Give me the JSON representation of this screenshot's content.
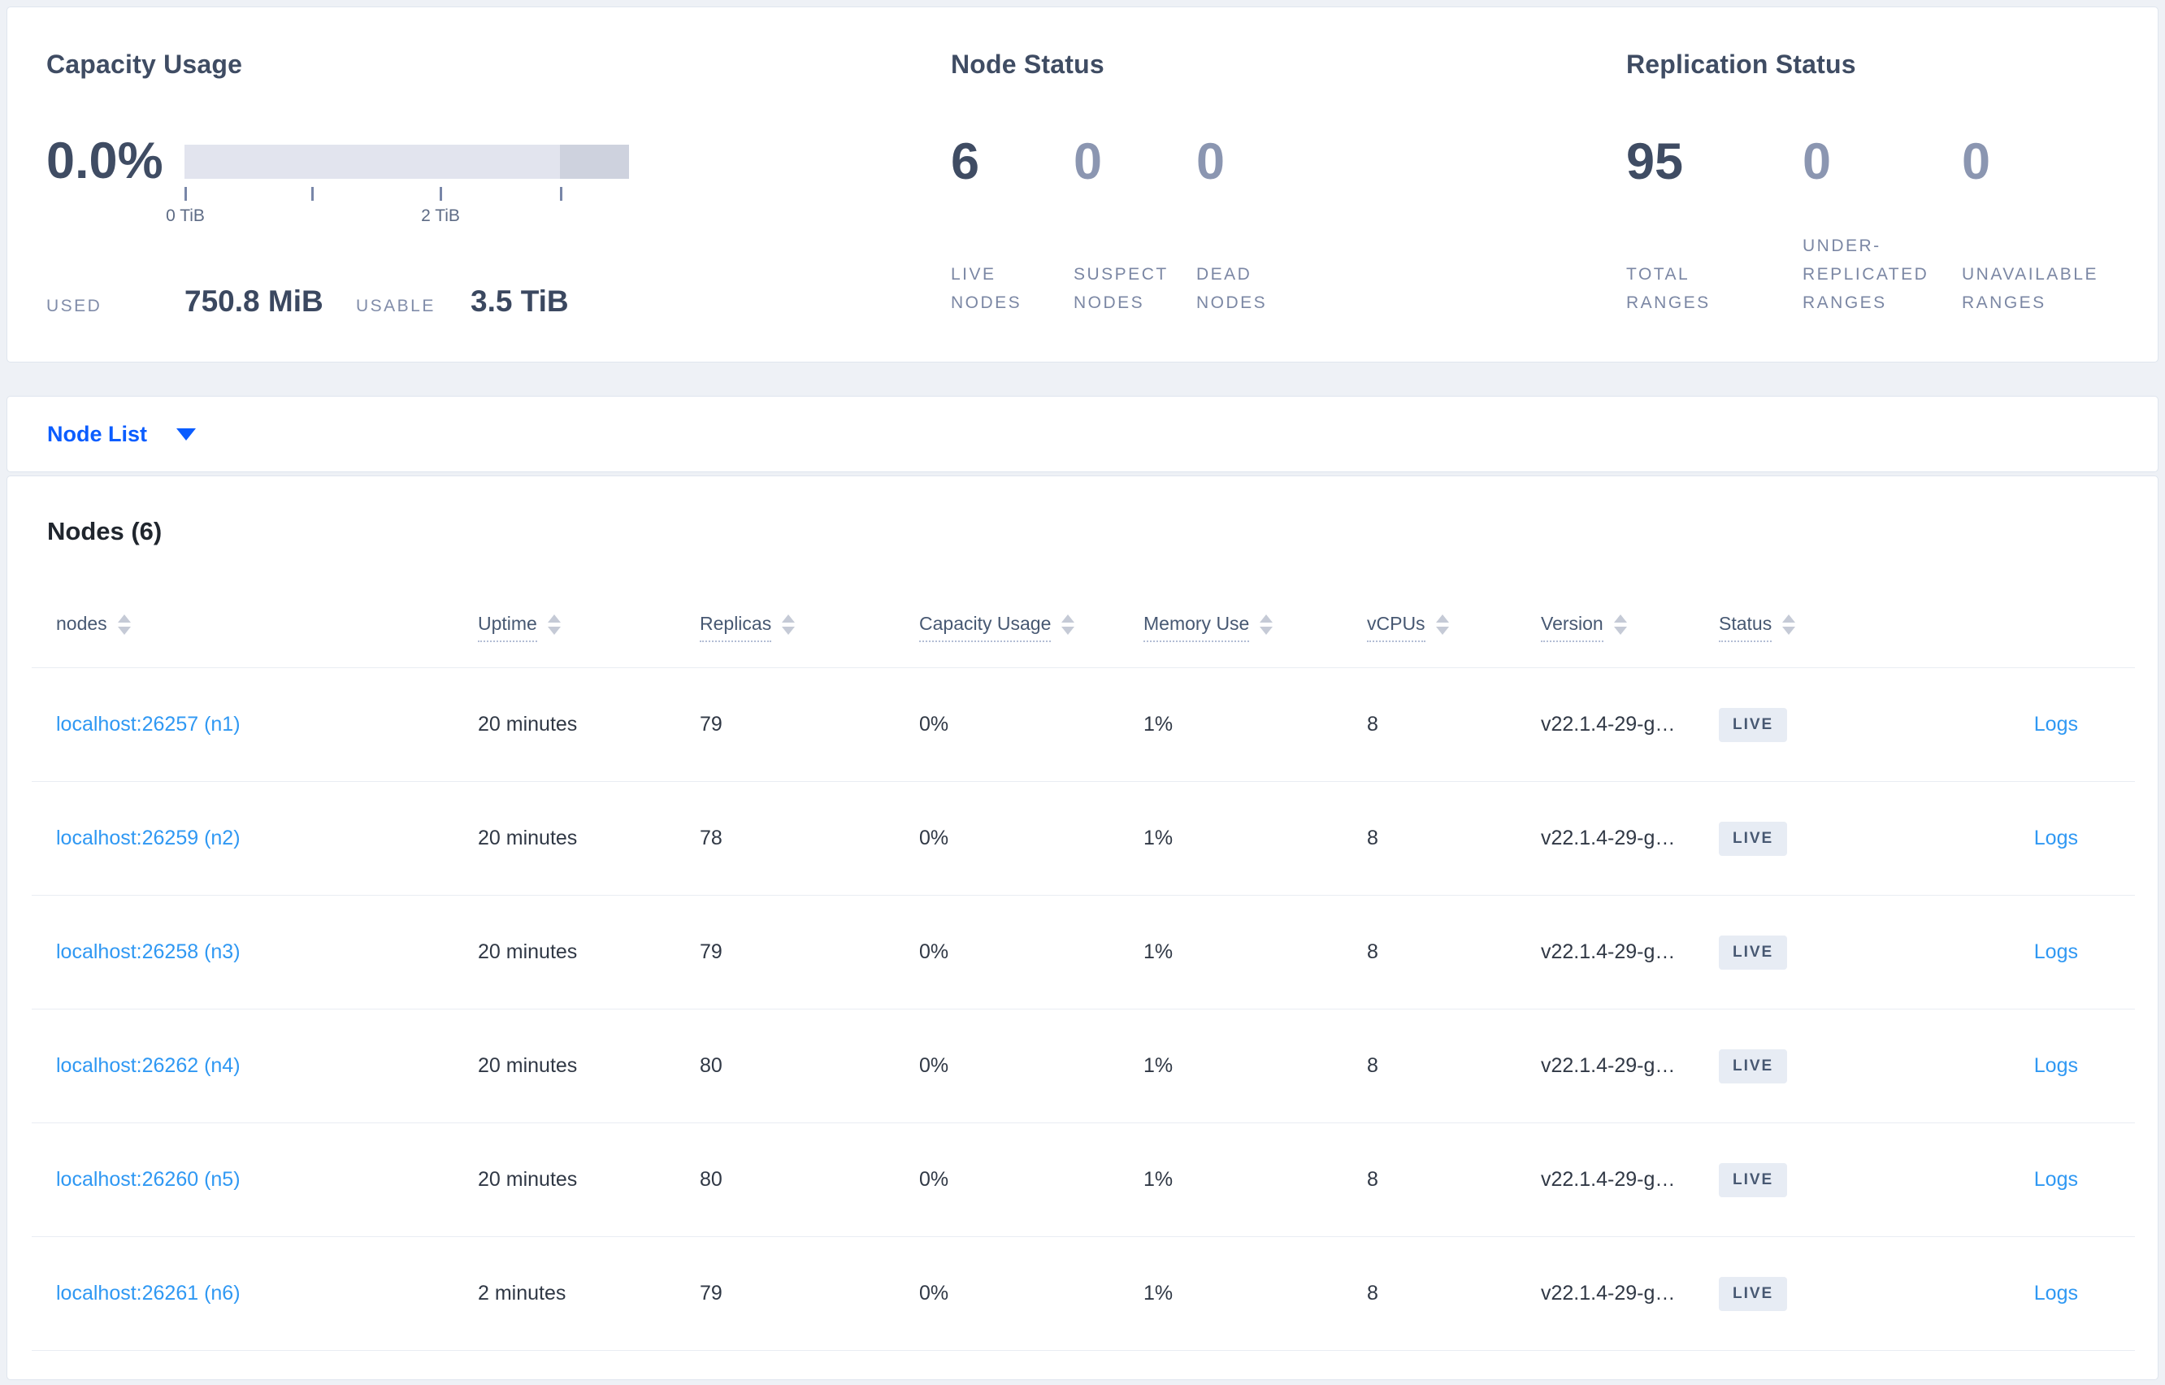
{
  "colors": {
    "accent_blue": "#0b5dff",
    "link_blue": "#2f98f3",
    "dark_slate": "#3f4c63",
    "muted_slate": "#8b96b1",
    "badge_bg": "#e7ecf4",
    "bar_track": "#e2e4ee",
    "bar_dark_segment": "#ced2de"
  },
  "top_cards": {
    "capacity": {
      "title": "Capacity Usage",
      "percent": "0.0%",
      "tick_labels": [
        "0 TiB",
        "2 TiB"
      ],
      "used_label": "USED",
      "used_value": "750.8 MiB",
      "usable_label": "USABLE",
      "usable_value": "3.5 TiB"
    },
    "node_status": {
      "title": "Node Status",
      "stats": [
        {
          "value": "6",
          "label": "LIVE NODES"
        },
        {
          "value": "0",
          "label": "SUSPECT NODES"
        },
        {
          "value": "0",
          "label": "DEAD NODES"
        }
      ]
    },
    "replication": {
      "title": "Replication Status",
      "stats": [
        {
          "value": "95",
          "label": "TOTAL RANGES"
        },
        {
          "value": "0",
          "label": "UNDER-REPLICATED RANGES"
        },
        {
          "value": "0",
          "label": "UNAVAILABLE RANGES"
        }
      ]
    }
  },
  "node_list_dropdown": {
    "label": "Node List"
  },
  "nodes_table": {
    "heading": "Nodes (6)",
    "logs_label": "Logs",
    "columns": [
      {
        "label": "nodes"
      },
      {
        "label": "Uptime"
      },
      {
        "label": "Replicas"
      },
      {
        "label": "Capacity Usage"
      },
      {
        "label": "Memory Use"
      },
      {
        "label": "vCPUs"
      },
      {
        "label": "Version"
      },
      {
        "label": "Status"
      }
    ],
    "rows": [
      {
        "node": "localhost:26257 (n1)",
        "uptime": "20 minutes",
        "replicas": "79",
        "capacity": "0%",
        "memory": "1%",
        "vcpus": "8",
        "version": "v22.1.4-29-g…",
        "status": "LIVE"
      },
      {
        "node": "localhost:26259 (n2)",
        "uptime": "20 minutes",
        "replicas": "78",
        "capacity": "0%",
        "memory": "1%",
        "vcpus": "8",
        "version": "v22.1.4-29-g…",
        "status": "LIVE"
      },
      {
        "node": "localhost:26258 (n3)",
        "uptime": "20 minutes",
        "replicas": "79",
        "capacity": "0%",
        "memory": "1%",
        "vcpus": "8",
        "version": "v22.1.4-29-g…",
        "status": "LIVE"
      },
      {
        "node": "localhost:26262 (n4)",
        "uptime": "20 minutes",
        "replicas": "80",
        "capacity": "0%",
        "memory": "1%",
        "vcpus": "8",
        "version": "v22.1.4-29-g…",
        "status": "LIVE"
      },
      {
        "node": "localhost:26260 (n5)",
        "uptime": "20 minutes",
        "replicas": "80",
        "capacity": "0%",
        "memory": "1%",
        "vcpus": "8",
        "version": "v22.1.4-29-g…",
        "status": "LIVE"
      },
      {
        "node": "localhost:26261 (n6)",
        "uptime": "2 minutes",
        "replicas": "79",
        "capacity": "0%",
        "memory": "1%",
        "vcpus": "8",
        "version": "v22.1.4-29-g…",
        "status": "LIVE"
      }
    ]
  }
}
